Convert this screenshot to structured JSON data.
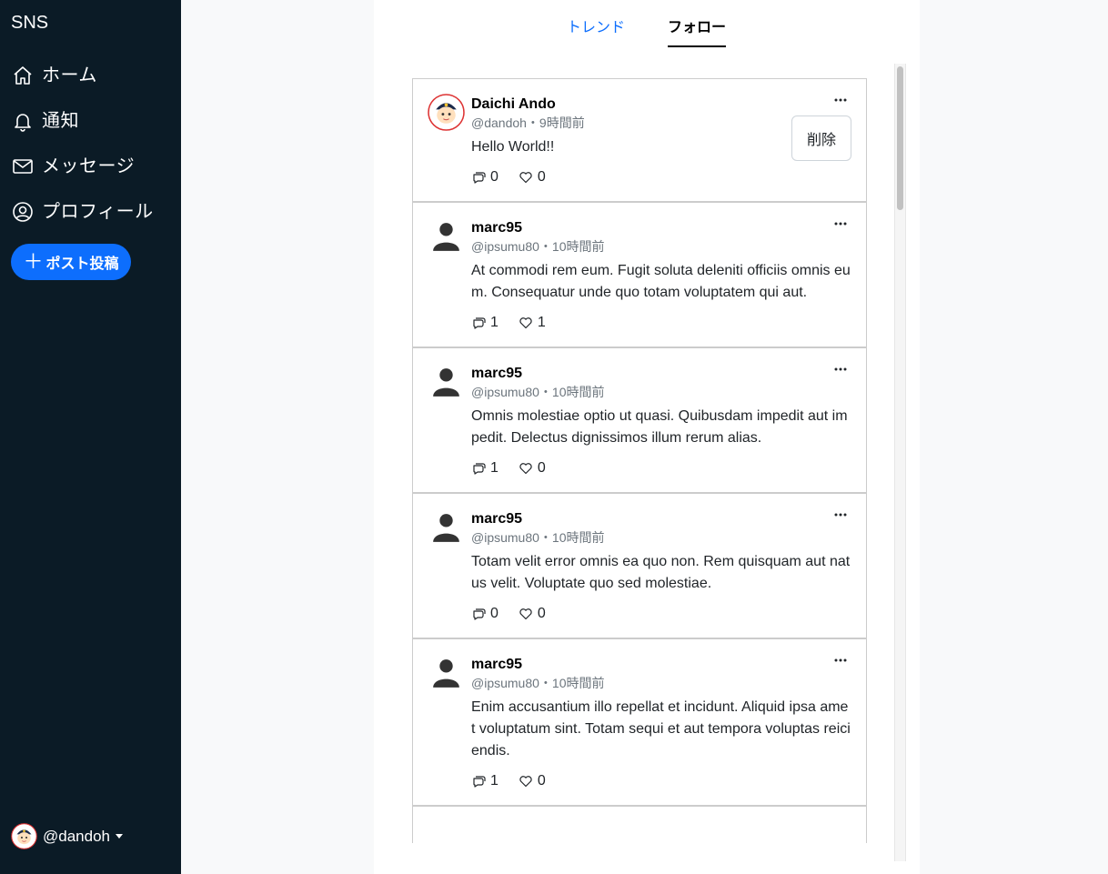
{
  "sidebar": {
    "brand": "SNS",
    "nav": [
      {
        "label": "ホーム",
        "icon": "home-icon"
      },
      {
        "label": "通知",
        "icon": "bell-icon"
      },
      {
        "label": "メッセージ",
        "icon": "envelope-icon"
      },
      {
        "label": "プロフィール",
        "icon": "person-circle-icon"
      }
    ],
    "post_button": "ポスト投稿",
    "account_handle": "@dandoh"
  },
  "tabs": [
    {
      "label": "トレンド",
      "active": false
    },
    {
      "label": "フォロー",
      "active": true
    }
  ],
  "posts": [
    {
      "name": "Daichi Ando",
      "handle": "@dandoh",
      "time": "9時間前",
      "meta": "@dandoh・9時間前",
      "body": "Hello World!!",
      "replies": "0",
      "likes": "0",
      "own": true,
      "delete_label": "削除"
    },
    {
      "name": "marc95",
      "handle": "@ipsumu80",
      "time": "10時間前",
      "meta": "@ipsumu80・10時間前",
      "body": "At commodi rem eum. Fugit soluta deleniti officiis omnis eum. Consequatur unde quo totam voluptatem qui aut.",
      "replies": "1",
      "likes": "1"
    },
    {
      "name": "marc95",
      "handle": "@ipsumu80",
      "time": "10時間前",
      "meta": "@ipsumu80・10時間前",
      "body": "Omnis molestiae optio ut quasi. Quibusdam impedit aut impedit. Delectus dignissimos illum rerum alias.",
      "replies": "1",
      "likes": "0"
    },
    {
      "name": "marc95",
      "handle": "@ipsumu80",
      "time": "10時間前",
      "meta": "@ipsumu80・10時間前",
      "body": "Totam velit error omnis ea quo non. Rem quisquam aut natus velit. Voluptate quo sed molestiae.",
      "replies": "0",
      "likes": "0"
    },
    {
      "name": "marc95",
      "handle": "@ipsumu80",
      "time": "10時間前",
      "meta": "@ipsumu80・10時間前",
      "body": "Enim accusantium illo repellat et incidunt. Aliquid ipsa amet voluptatum sint. Totam sequi et aut tempora voluptas reiciendis.",
      "replies": "1",
      "likes": "0"
    }
  ],
  "colors": {
    "sidebar_bg": "#0b1b26",
    "accent": "#0d6efd",
    "border": "#cccccc"
  }
}
